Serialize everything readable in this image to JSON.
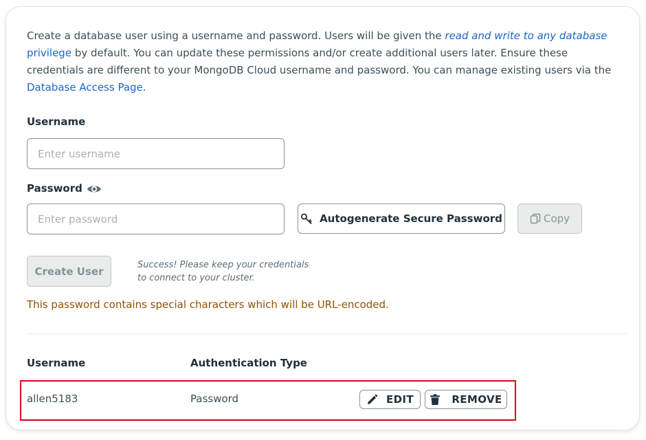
{
  "intro": {
    "text_before": "Create a database user using a username and password. Users will be given the ",
    "privilege_em": "read and write to any database",
    "privilege_link": "privilege",
    "text_middle": " by default. You can update these permissions and/or create additional users later. Ensure these credentials are different to your MongoDB Cloud username and password. You can manage existing users via the ",
    "access_link": "Database Access Page",
    "text_end": "."
  },
  "form": {
    "username_label": "Username",
    "username_placeholder": "Enter username",
    "username_value": "",
    "password_label": "Password",
    "password_placeholder": "Enter password",
    "password_value": "",
    "autogenerate_label": "Autogenerate Secure Password",
    "copy_label": "Copy",
    "create_label": "Create User",
    "success_line1": "Success! Please keep your credentials",
    "success_line2": "to connect to your cluster.",
    "warning": "This password contains special characters which will be URL-encoded."
  },
  "table": {
    "headers": [
      "Username",
      "Authentication Type"
    ],
    "rows": [
      {
        "username": "allen5183",
        "auth_type": "Password",
        "edit_label": "EDIT",
        "remove_label": "REMOVE"
      }
    ]
  },
  "icons": {
    "eye": "eye-icon",
    "key": "key-icon",
    "copy": "copy-icon",
    "edit": "pencil-icon",
    "remove": "trash-icon"
  },
  "colors": {
    "link": "#1a66c9",
    "warning": "#944f01",
    "highlight_border": "#d9001b"
  }
}
